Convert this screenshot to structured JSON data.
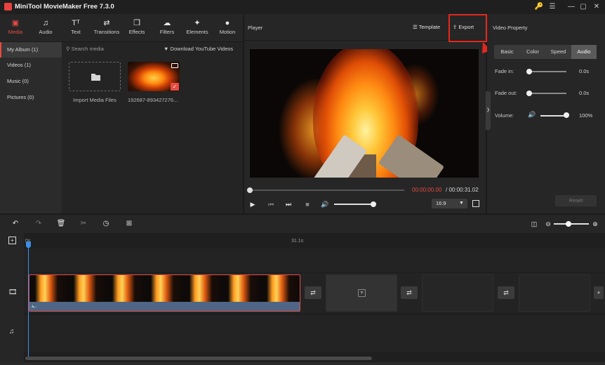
{
  "app": {
    "title": "MiniTool MovieMaker Free 7.3.0"
  },
  "media_tabs": [
    {
      "label": "Media",
      "icon": "folder-icon"
    },
    {
      "label": "Audio",
      "icon": "music-note-icon"
    },
    {
      "label": "Text",
      "icon": "text-icon"
    },
    {
      "label": "Transitions",
      "icon": "transition-arrows-icon"
    },
    {
      "label": "Effects",
      "icon": "effects-icon"
    },
    {
      "label": "Filters",
      "icon": "filters-icon"
    },
    {
      "label": "Elements",
      "icon": "elements-icon"
    },
    {
      "label": "Motion",
      "icon": "motion-icon"
    }
  ],
  "albums": [
    {
      "label": "My Album (1)",
      "active": true
    },
    {
      "label": "Videos (1)"
    },
    {
      "label": "Music (0)"
    },
    {
      "label": "Pictures (0)"
    }
  ],
  "media": {
    "search_placeholder": "Search media",
    "download_label": "Download YouTube Videos",
    "import_label": "Import Media Files",
    "clip_name": "192687-893427276..."
  },
  "player": {
    "title": "Player",
    "template_label": "Template",
    "export_label": "Export",
    "time_current": "00:00:00.00",
    "time_total": "/ 00:00:31.02",
    "aspect_ratio": "16:9",
    "seek_progress": 0,
    "volume_level": 1
  },
  "video_property": {
    "title": "Video Property",
    "tabs": [
      "Basic",
      "Color",
      "Speed",
      "Audio"
    ],
    "active_tab": "Audio",
    "fade_in_label": "Fade in:",
    "fade_in_value": "0.0s",
    "fade_out_label": "Fade out:",
    "fade_out_value": "0.0s",
    "volume_label": "Volume:",
    "volume_value": "100%",
    "reset_label": "Reset"
  },
  "timeline": {
    "ruler_start": "0s",
    "ruler_end": "31.1s"
  },
  "colors": {
    "accent": "#e64b43",
    "playhead": "#3b8ee8",
    "annotation": "#e3281f"
  }
}
